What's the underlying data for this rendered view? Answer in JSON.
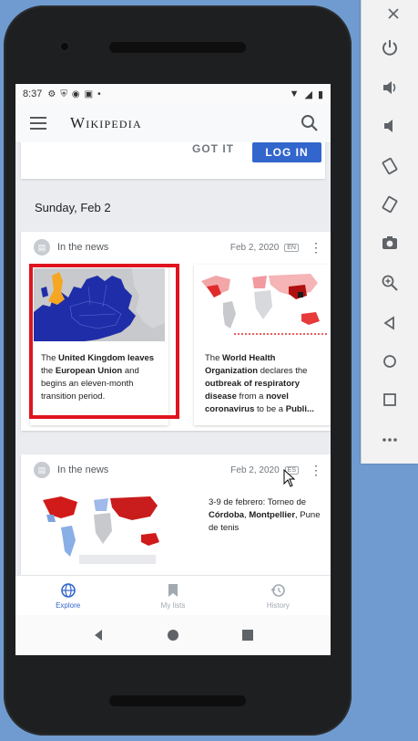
{
  "status_bar": {
    "time": "8:37"
  },
  "app_bar": {
    "title": "Wikipedia"
  },
  "onboarding": {
    "got_it": "GOT IT",
    "log_in": "LOG IN"
  },
  "feed": {
    "date_header": "Sunday, Feb 2",
    "cards": [
      {
        "title": "In the news",
        "date": "Feb 2, 2020",
        "lang": "EN",
        "stories": [
          {
            "p1": "The ",
            "b1": "United Kingdom leaves",
            "p2": " the ",
            "b2": "European Union",
            "p3": " and begins an eleven-month transition period."
          },
          {
            "p1": "The ",
            "b1": "World Health Organization",
            "p2": " declares the ",
            "b2": "outbreak of respiratory disease",
            "p3": " from a ",
            "b3": "novel coronavirus",
            "p4": " to be a ",
            "b4": "Publi..."
          }
        ]
      },
      {
        "title": "In the news",
        "date": "Feb 2, 2020",
        "lang": "ES",
        "stories": [
          {
            "p1": "3-9 de febrero: Torneo de ",
            "b1": "Córdoba",
            "p2": ", ",
            "b2": "Montpellier",
            "p3": ", Pune de tenis"
          }
        ]
      }
    ]
  },
  "bottom_nav": {
    "tabs": [
      {
        "label": "Explore"
      },
      {
        "label": "My lists"
      },
      {
        "label": "History"
      }
    ]
  },
  "colors": {
    "accent": "#3366cc",
    "highlight": "#e0141e",
    "eu_blue": "#1f2ea8",
    "uk_orange": "#f5a623"
  }
}
